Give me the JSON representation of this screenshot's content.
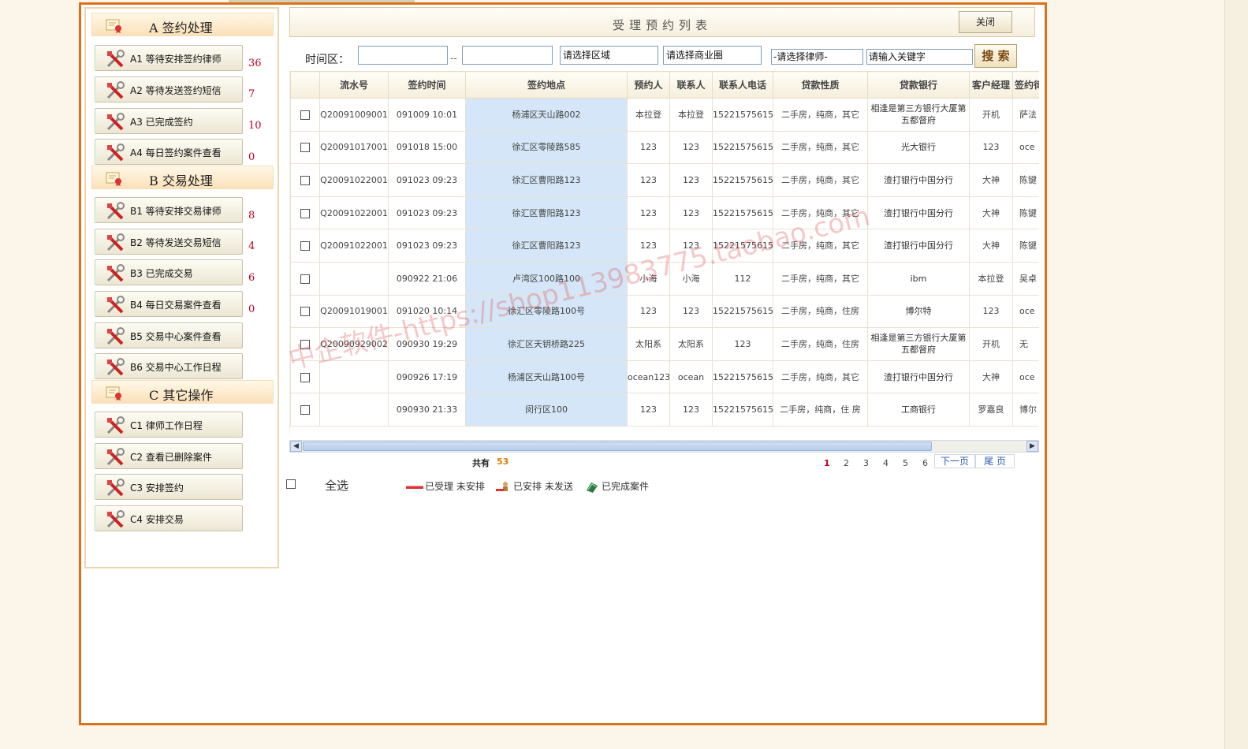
{
  "sidebar": {
    "sections": [
      {
        "label": "A 签约处理",
        "items": [
          {
            "label": "A1 等待安排签约律师",
            "count": "36"
          },
          {
            "label": "A2 等待发送签约短信",
            "count": "7"
          },
          {
            "label": "A3 已完成签约",
            "count": "10"
          },
          {
            "label": "A4 每日签约案件查看",
            "count": "0"
          }
        ]
      },
      {
        "label": "B 交易处理",
        "items": [
          {
            "label": "B1 等待安排交易律师",
            "count": "8"
          },
          {
            "label": "B2 等待发送交易短信",
            "count": "4"
          },
          {
            "label": "B3 已完成交易",
            "count": "6"
          },
          {
            "label": "B4 每日交易案件查看",
            "count": "0"
          },
          {
            "label": "B5 交易中心案件查看"
          },
          {
            "label": "B6 交易中心工作日程"
          }
        ]
      },
      {
        "label": "C 其它操作",
        "items": [
          {
            "label": "C1 律师工作日程"
          },
          {
            "label": "C2 查看已删除案件"
          },
          {
            "label": "C3 安排签约"
          },
          {
            "label": "C4 安排交易"
          }
        ]
      }
    ]
  },
  "main": {
    "title": "受理预约列表",
    "close_label": "关闭"
  },
  "search": {
    "time_label": "时间区：",
    "date_from": "",
    "date_sep": "--",
    "date_to": "",
    "region": "请选择区域",
    "business_area": "请选择商业圈",
    "lawyer": "-请选择律师-",
    "keyword": "请输入关键字",
    "search_label": "搜 索"
  },
  "table": {
    "columns": [
      "",
      "流水号",
      "签约时间",
      "签约地点",
      "预约人",
      "联系人",
      "联系人电话",
      "贷款性质",
      "贷款银行",
      "客户经理",
      "签约律"
    ],
    "rows": [
      [
        "Q20091009001",
        "091009 10:01",
        "杨浦区天山路002",
        "本拉登",
        "本拉登",
        "15221575615",
        "二手房，纯商，其它",
        "相逢是第三方银行大厦第五都督府",
        "开机",
        "萨法"
      ],
      [
        "Q20091017001",
        "091018 15:00",
        "徐汇区零陵路585",
        "123",
        "123",
        "15221575615",
        "二手房，纯商，其它",
        "光大银行",
        "123",
        "oce"
      ],
      [
        "Q20091022001",
        "091023 09:23",
        "徐汇区曹阳路123",
        "123",
        "123",
        "15221575615",
        "二手房，纯商，其它",
        "渣打银行中国分行",
        "大神",
        "陈键"
      ],
      [
        "Q20091022001",
        "091023 09:23",
        "徐汇区曹阳路123",
        "123",
        "123",
        "15221575615",
        "二手房，纯商，其它",
        "渣打银行中国分行",
        "大神",
        "陈键"
      ],
      [
        "Q20091022001",
        "091023 09:23",
        "徐汇区曹阳路123",
        "123",
        "123",
        "15221575615",
        "二手房，纯商，其它",
        "渣打银行中国分行",
        "大神",
        "陈键"
      ],
      [
        "",
        "090922 21:06",
        "卢湾区100路100",
        "小海",
        "小海",
        "112",
        "二手房，纯商，其它",
        "ibm",
        "本拉登",
        "吴卓"
      ],
      [
        "Q20091019001",
        "091020 10:14",
        "徐汇区零陵路100号",
        "123",
        "123",
        "15221575615",
        "二手房，纯商，住房",
        "博尔特",
        "123",
        "oce"
      ],
      [
        "Q20090929002",
        "090930 19:29",
        "徐汇区天钥桥路225",
        "太阳系",
        "太阳系",
        "123",
        "二手房，纯商，住房",
        "相逢是第三方银行大厦第五都督府",
        "开机",
        "无"
      ],
      [
        "",
        "090926 17:19",
        "杨浦区天山路100号",
        "ocean123",
        "ocean",
        "15221575615",
        "二手房，纯商，其它",
        "渣打银行中国分行",
        "大神",
        "oce"
      ],
      [
        "",
        "090930 21:33",
        "闵行区100",
        "123",
        "123",
        "15221575615",
        "二手房，纯商，住 房",
        "工商银行",
        "罗嘉良",
        "博尔"
      ]
    ]
  },
  "pager": {
    "total_label": "共有",
    "total": "53",
    "pages": [
      "1",
      "2",
      "3",
      "4",
      "5",
      "6"
    ],
    "current": "1",
    "next_label": "下一页",
    "last_label": "尾 页"
  },
  "footer": {
    "select_all": "全选",
    "legend": [
      {
        "icon": "accepted-unarranged-icon",
        "label": "已受理 未安排"
      },
      {
        "icon": "arranged-unsent-icon",
        "label": "已安排 未发送"
      },
      {
        "icon": "completed-case-icon",
        "label": "已完成案件"
      }
    ]
  },
  "watermark": "中企软件-https://shop113983775.taobao.com",
  "colors": {
    "frame": "#d9721b",
    "count": "#c0001e",
    "address_cell": "#d4e6f7",
    "total": "#d67d00"
  }
}
